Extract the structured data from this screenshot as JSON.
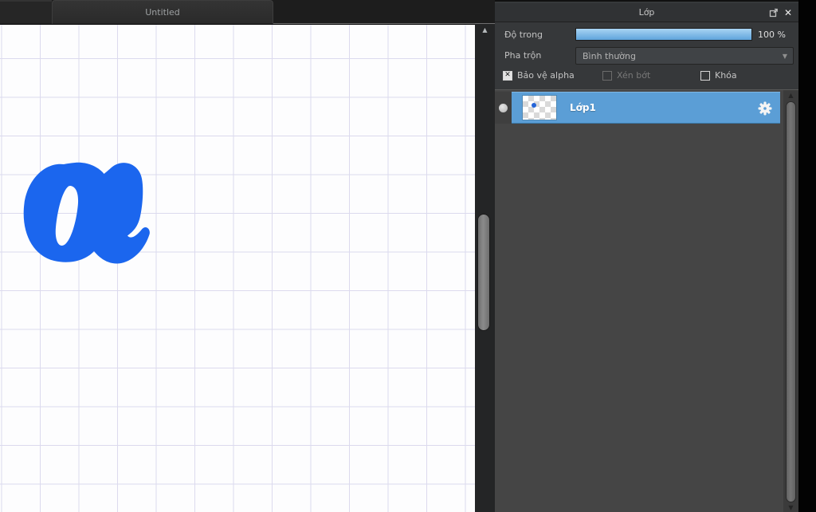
{
  "tab_bar": {
    "active_tab": "Untitled"
  },
  "canvas": {
    "artwork_letter": "a",
    "letter_color": "#1b66ee",
    "grid_color": "#dcdaee",
    "background": "#fdfdfe"
  },
  "layer_panel": {
    "title": "Lớp",
    "close_glyph": "✕",
    "opacity": {
      "label": "Độ trong",
      "value_percent": 100,
      "value_text": "100 %"
    },
    "blend": {
      "label": "Pha trộn",
      "selected": "Bình thường",
      "arrow_glyph": "▼"
    },
    "checkboxes": [
      {
        "label": "Bảo vệ alpha",
        "checked": true,
        "enabled": true,
        "mark": "✕"
      },
      {
        "label": "Xén bớt",
        "checked": false,
        "enabled": false,
        "mark": ""
      },
      {
        "label": "Khóa",
        "checked": false,
        "enabled": true,
        "mark": ""
      }
    ],
    "layers": [
      {
        "name": "Lớp1",
        "selected": true,
        "visible": true
      }
    ],
    "selection_color": "#5b9ed6",
    "slider_gradient_top": "#a9d4f3",
    "slider_gradient_bottom": "#5fa4dc"
  },
  "scrollbars": {
    "up_glyph": "▲",
    "down_glyph": "▼"
  }
}
